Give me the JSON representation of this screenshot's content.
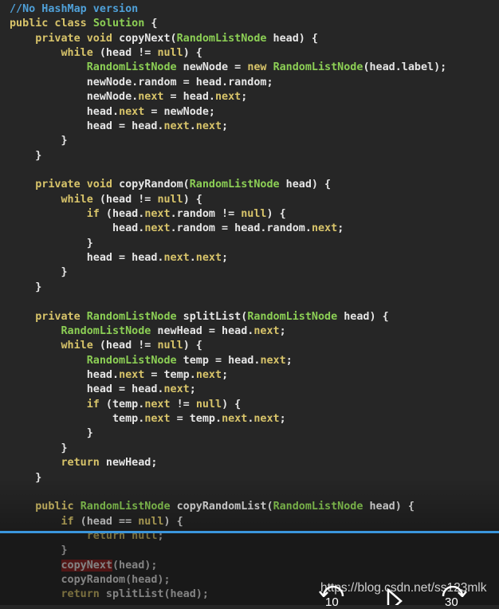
{
  "code_lines": [
    [
      [
        "cm",
        "//No HashMap version"
      ]
    ],
    [
      [
        "kw",
        "public class "
      ],
      [
        "ty",
        "Solution"
      ],
      [
        "pl",
        " {"
      ]
    ],
    [
      [
        "pl",
        "    "
      ],
      [
        "kw",
        "private void "
      ],
      [
        "pl",
        "copyNext("
      ],
      [
        "ty",
        "RandomListNode"
      ],
      [
        "pl",
        " head) {"
      ]
    ],
    [
      [
        "pl",
        "        "
      ],
      [
        "kw",
        "while"
      ],
      [
        "pl",
        " (head != "
      ],
      [
        "kw",
        "null"
      ],
      [
        "pl",
        ") {"
      ]
    ],
    [
      [
        "pl",
        "            "
      ],
      [
        "ty",
        "RandomListNode"
      ],
      [
        "pl",
        " newNode = "
      ],
      [
        "kw",
        "new "
      ],
      [
        "ty",
        "RandomListNode"
      ],
      [
        "pl",
        "(head.label);"
      ]
    ],
    [
      [
        "pl",
        "            newNode.random = head.random;"
      ]
    ],
    [
      [
        "pl",
        "            newNode."
      ],
      [
        "kw",
        "next"
      ],
      [
        "pl",
        " = head."
      ],
      [
        "kw",
        "next"
      ],
      [
        "pl",
        ";"
      ]
    ],
    [
      [
        "pl",
        "            head."
      ],
      [
        "kw",
        "next"
      ],
      [
        "pl",
        " = newNode;"
      ]
    ],
    [
      [
        "pl",
        "            head = head."
      ],
      [
        "kw",
        "next"
      ],
      [
        "pl",
        "."
      ],
      [
        "kw",
        "next"
      ],
      [
        "pl",
        ";"
      ]
    ],
    [
      [
        "pl",
        "        }"
      ]
    ],
    [
      [
        "pl",
        "    }"
      ]
    ],
    [
      [
        "pl",
        ""
      ]
    ],
    [
      [
        "pl",
        "    "
      ],
      [
        "kw",
        "private void "
      ],
      [
        "pl",
        "copyRandom("
      ],
      [
        "ty",
        "RandomListNode"
      ],
      [
        "pl",
        " head) {"
      ]
    ],
    [
      [
        "pl",
        "        "
      ],
      [
        "kw",
        "while"
      ],
      [
        "pl",
        " (head != "
      ],
      [
        "kw",
        "null"
      ],
      [
        "pl",
        ") {"
      ]
    ],
    [
      [
        "pl",
        "            "
      ],
      [
        "kw",
        "if"
      ],
      [
        "pl",
        " (head."
      ],
      [
        "kw",
        "next"
      ],
      [
        "pl",
        ".random != "
      ],
      [
        "kw",
        "null"
      ],
      [
        "pl",
        ") {"
      ]
    ],
    [
      [
        "pl",
        "                head."
      ],
      [
        "kw",
        "next"
      ],
      [
        "pl",
        ".random = head.random."
      ],
      [
        "kw",
        "next"
      ],
      [
        "pl",
        ";"
      ]
    ],
    [
      [
        "pl",
        "            }"
      ]
    ],
    [
      [
        "pl",
        "            head = head."
      ],
      [
        "kw",
        "next"
      ],
      [
        "pl",
        "."
      ],
      [
        "kw",
        "next"
      ],
      [
        "pl",
        ";"
      ]
    ],
    [
      [
        "pl",
        "        }"
      ]
    ],
    [
      [
        "pl",
        "    }"
      ]
    ],
    [
      [
        "pl",
        ""
      ]
    ],
    [
      [
        "pl",
        "    "
      ],
      [
        "kw",
        "private "
      ],
      [
        "ty",
        "RandomListNode"
      ],
      [
        "pl",
        " splitList("
      ],
      [
        "ty",
        "RandomListNode"
      ],
      [
        "pl",
        " head) {"
      ]
    ],
    [
      [
        "pl",
        "        "
      ],
      [
        "ty",
        "RandomListNode"
      ],
      [
        "pl",
        " newHead = head."
      ],
      [
        "kw",
        "next"
      ],
      [
        "pl",
        ";"
      ]
    ],
    [
      [
        "pl",
        "        "
      ],
      [
        "kw",
        "while"
      ],
      [
        "pl",
        " (head != "
      ],
      [
        "kw",
        "null"
      ],
      [
        "pl",
        ") {"
      ]
    ],
    [
      [
        "pl",
        "            "
      ],
      [
        "ty",
        "RandomListNode"
      ],
      [
        "pl",
        " temp = head."
      ],
      [
        "kw",
        "next"
      ],
      [
        "pl",
        ";"
      ]
    ],
    [
      [
        "pl",
        "            head."
      ],
      [
        "kw",
        "next"
      ],
      [
        "pl",
        " = temp."
      ],
      [
        "kw",
        "next"
      ],
      [
        "pl",
        ";"
      ]
    ],
    [
      [
        "pl",
        "            head = head."
      ],
      [
        "kw",
        "next"
      ],
      [
        "pl",
        ";"
      ]
    ],
    [
      [
        "pl",
        "            "
      ],
      [
        "kw",
        "if"
      ],
      [
        "pl",
        " (temp."
      ],
      [
        "kw",
        "next"
      ],
      [
        "pl",
        " != "
      ],
      [
        "kw",
        "null"
      ],
      [
        "pl",
        ") {"
      ]
    ],
    [
      [
        "pl",
        "                temp."
      ],
      [
        "kw",
        "next"
      ],
      [
        "pl",
        " = temp."
      ],
      [
        "kw",
        "next"
      ],
      [
        "pl",
        "."
      ],
      [
        "kw",
        "next"
      ],
      [
        "pl",
        ";"
      ]
    ],
    [
      [
        "pl",
        "            }"
      ]
    ],
    [
      [
        "pl",
        "        }"
      ]
    ],
    [
      [
        "pl",
        "        "
      ],
      [
        "kw",
        "return"
      ],
      [
        "pl",
        " newHead;"
      ]
    ],
    [
      [
        "pl",
        "    }"
      ]
    ],
    [
      [
        "pl",
        ""
      ]
    ],
    [
      [
        "pl",
        "    "
      ],
      [
        "kw",
        "public "
      ],
      [
        "ty",
        "RandomListNode"
      ],
      [
        "pl",
        " copyRandomList("
      ],
      [
        "ty",
        "RandomListNode"
      ],
      [
        "pl",
        " head) {"
      ]
    ],
    [
      [
        "pl",
        "        "
      ],
      [
        "kw",
        "if"
      ],
      [
        "pl",
        " (head == "
      ],
      [
        "kw",
        "null"
      ],
      [
        "pl",
        ") {"
      ]
    ],
    [
      [
        "pl",
        "            "
      ],
      [
        "kw",
        "return null"
      ],
      [
        "pl",
        ";"
      ]
    ],
    [
      [
        "pl",
        "        }"
      ]
    ],
    [
      [
        "pl",
        "        "
      ],
      [
        "hl",
        "copyNext"
      ],
      [
        "pl",
        "(head);"
      ]
    ],
    [
      [
        "pl",
        "        copyRandom(head);"
      ]
    ],
    [
      [
        "pl",
        "        "
      ],
      [
        "kw",
        "return"
      ],
      [
        "pl",
        " splitList(head);"
      ]
    ]
  ],
  "player": {
    "progress_color": "#3a96dd",
    "rewind_seconds": "10",
    "forward_seconds": "30",
    "rewind_icon": "rewind-10-icon",
    "play_icon": "play-icon",
    "forward_icon": "forward-30-icon"
  },
  "watermark": "https://blog.csdn.net/ss123mlk"
}
